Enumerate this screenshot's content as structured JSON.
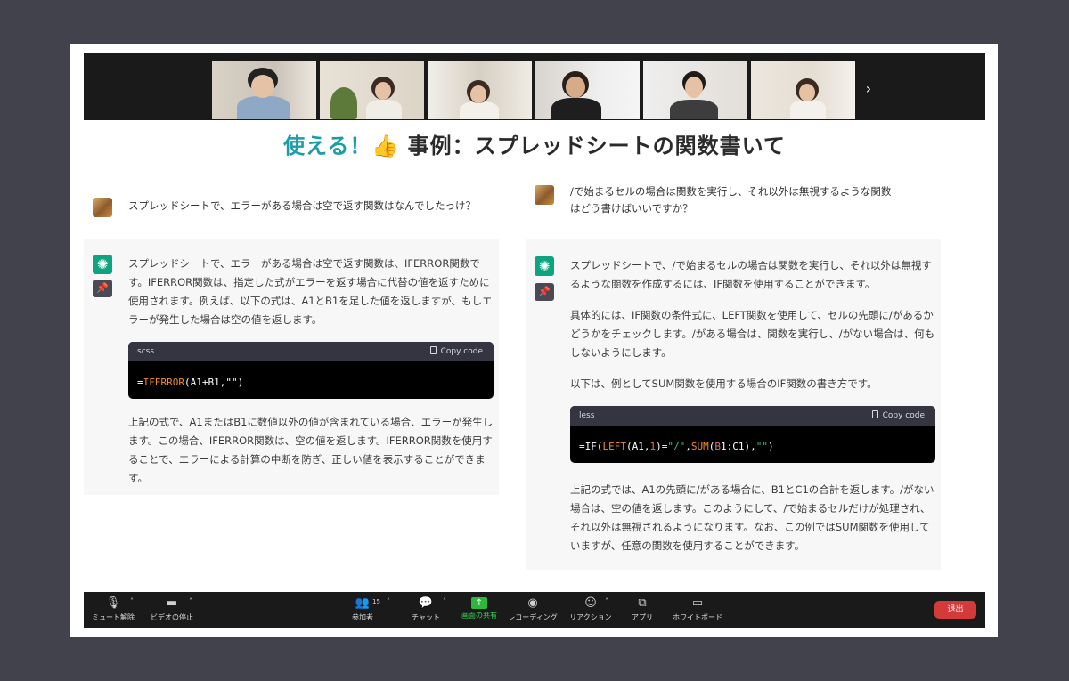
{
  "slide": {
    "title_accent": "使える！",
    "title_emoji": "👍",
    "title_main": "事例：スプレッドシートの関数書いて"
  },
  "strip": {
    "next_icon": "chevron-right",
    "next_label": "›"
  },
  "left": {
    "question": "スプレッドシートで、エラーがある場合は空で返す関数はなんでしたっけ？",
    "answer_p1": "スプレッドシートで、エラーがある場合は空で返す関数は、IFERROR関数です。IFERROR関数は、指定した式がエラーを返す場合に代替の値を返すために使用されます。例えば、以下の式は、A1とB1を足した値を返しますが、もしエラーが発生した場合は空の値を返します。",
    "code_lang": "scss",
    "copy_label": "Copy code",
    "code": {
      "eq": "=",
      "fn": "IFERROR",
      "rest": "(A1+B1,\"\")"
    },
    "answer_p2": "上記の式で、A1またはB1に数値以外の値が含まれている場合、エラーが発生します。この場合、IFERROR関数は、空の値を返します。IFERROR関数を使用することで、エラーによる計算の中断を防ぎ、正しい値を表示することができます。"
  },
  "right": {
    "question": "/で始まるセルの場合は関数を実行し、それ以外は無視するような関数はどう書けばいいですか？",
    "answer_p1": "スプレッドシートで、/で始まるセルの場合は関数を実行し、それ以外は無視するような関数を作成するには、IF関数を使用することができます。",
    "answer_p2": "具体的には、IF関数の条件式に、LEFT関数を使用して、セルの先頭に/があるかどうかをチェックします。/がある場合は、関数を実行し、/がない場合は、何もしないようにします。",
    "answer_p3": "以下は、例としてSUM関数を使用する場合のIF関数の書き方です。",
    "code_lang": "less",
    "copy_label": "Copy code",
    "code": {
      "a": "=IF(",
      "fn1": "LEFT",
      "b": "(A1,",
      "n1": "1",
      "c": ")=",
      "s1": "\"/\"",
      "d": ",",
      "fn2": "SUM",
      "e": "(",
      "b1": "B",
      "f": "1:C1),",
      "s2": "\"\"",
      "g": ")"
    },
    "answer_p4": "上記の式では、A1の先頭に/がある場合に、B1とC1の合計を返します。/がない場合は、空の値を返します。このようにして、/で始まるセルだけが処理され、それ以外は無視されるようになります。なお、この例ではSUM関数を使用していますが、任意の関数を使用することができます。"
  },
  "toolbar": {
    "mute": "ミュート解除",
    "video": "ビデオの停止",
    "participants": "参加者",
    "participants_count": "15",
    "chat": "チャット",
    "share": "画面の共有",
    "record": "レコーディング",
    "reaction": "リアクション",
    "apps": "アプリ",
    "whiteboard": "ホワイトボード",
    "leave": "退出"
  },
  "colors": {
    "accent": "#1b9cab",
    "share_green": "#39d353",
    "leave_red": "#d33b3b",
    "gpt_green": "#10a37f"
  }
}
